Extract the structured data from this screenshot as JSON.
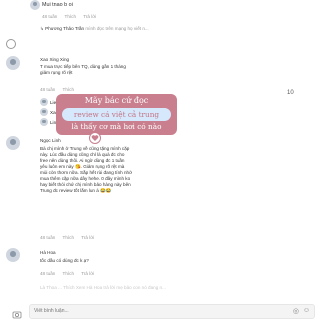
{
  "top_comment": {
    "author": "Mui tnao b oi",
    "meta": [
      "48 tuần",
      "Thích",
      "Trả lời"
    ]
  },
  "reply_preview": {
    "author": "Phương Thảo Trần",
    "text": "mình đọc trên mạng họ viết n..."
  },
  "comment_xao": {
    "author": "Xao Xing Xing",
    "text_lines": [
      "T mua trực tiếp bên TQ, dùng gần 1 tháng",
      "giảm rụng rõ rệt"
    ],
    "meta": [
      "48 tuần",
      "Thích"
    ],
    "likes": "10"
  },
  "hidden_replies": [
    {
      "author": "Lien"
    },
    {
      "author": "Xao"
    },
    {
      "author": "Linh"
    }
  ],
  "overlay": {
    "line1": "Mãy bác cứ đọc",
    "line2": "review cá việt cả trung",
    "line3": "là thấy cơ mà hơi có nào"
  },
  "comment_ngoc": {
    "author": "Ngọc Linh",
    "text_lines": [
      "Bà chị mình ở Trung về cũng tặng mình cặp",
      "này. Lúc đầu dùng cũng chỉ là quà đc cho",
      "free nên dùng thôi. Ai ngờ dùng đc 1 tuần",
      "yêu luôn em này 😘. Giảm rụng rõ rệt mà",
      "mùi còn thơm nữa. Sắp hết rùi đang tính nhờ",
      "mua thêm cặp nữa dây hehe. 0 đây mình ko",
      "hay biết thói chứ chị mình bảo hàng này bên",
      "Trung đc review tốt lắm lun á 😂😂"
    ],
    "meta": [
      "48 tuần",
      "Thích",
      "Trả lời"
    ]
  },
  "comment_hoa": {
    "author": "Hà Hoa",
    "text": "tốc dầu có dùng đc k ạ?",
    "meta": [
      "48 tuần",
      "Thích",
      "Trả lời"
    ]
  },
  "more_hint": "Là Thoa ... Thích Xem Hà Hoa trả lời mẹ bảo con nó đang n...",
  "input": {
    "placeholder": "Viết bình luận..."
  },
  "colors": {
    "overlay_bg": "#c97f8e",
    "overlay_pill": "#d6e8fb"
  }
}
